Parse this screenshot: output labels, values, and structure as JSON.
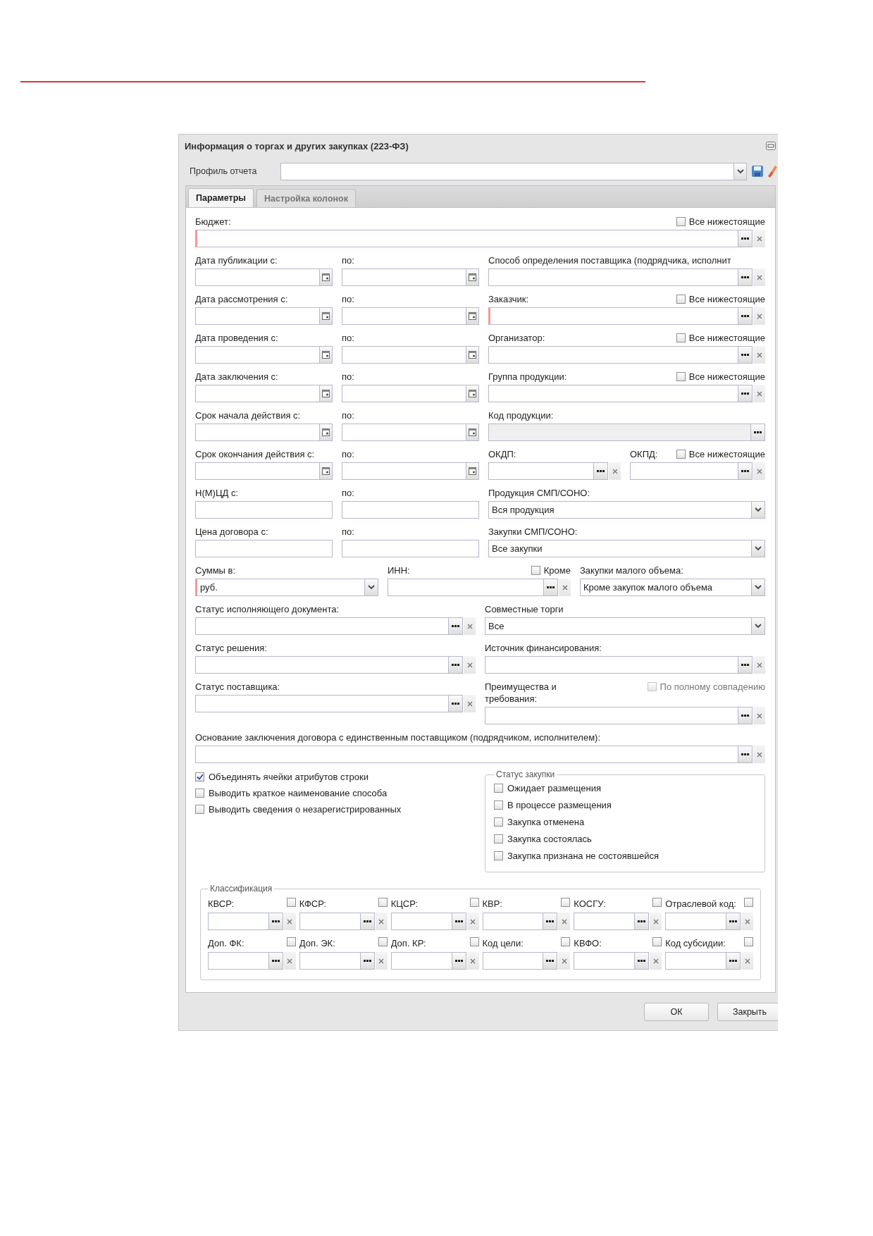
{
  "dialog": {
    "title": "Информация о торгах и других закупках (223-ФЗ)"
  },
  "profile": {
    "label": "Профиль отчета"
  },
  "tabs": [
    {
      "label": "Параметры",
      "selected": true
    },
    {
      "label": "Настройка колонок",
      "selected": false
    }
  ],
  "rows": [
    {
      "kind": "full",
      "cells": [
        {
          "label": "Бюджет:",
          "checkbox": {
            "label": "Все нижестоящие",
            "checked": false,
            "disabled": false
          },
          "field": {
            "kind": "lookup",
            "required": true,
            "disabled": false
          }
        }
      ]
    },
    {
      "kind": "dates",
      "cells": [
        {
          "label": "Дата публикации с:",
          "field": {
            "kind": "date",
            "required": false,
            "disabled": false
          }
        },
        {
          "label": "по:",
          "field": {
            "kind": "date",
            "required": false,
            "disabled": false
          }
        },
        {
          "label": "Способ определения поставщика (подрядчика, исполнит",
          "field": {
            "kind": "lookup",
            "required": false,
            "disabled": false
          }
        }
      ]
    },
    {
      "kind": "dates",
      "cells": [
        {
          "label": "Дата рассмотрения с:",
          "field": {
            "kind": "date",
            "required": false,
            "disabled": false
          }
        },
        {
          "label": "по:",
          "field": {
            "kind": "date",
            "required": false,
            "disabled": false
          }
        },
        {
          "label": "Заказчик:",
          "checkbox": {
            "label": "Все нижестоящие",
            "checked": false,
            "disabled": false
          },
          "field": {
            "kind": "lookup",
            "required": true,
            "disabled": false
          }
        }
      ]
    },
    {
      "kind": "dates",
      "cells": [
        {
          "label": "Дата проведения с:",
          "field": {
            "kind": "date",
            "required": false,
            "disabled": false
          }
        },
        {
          "label": "по:",
          "field": {
            "kind": "date",
            "required": false,
            "disabled": false
          }
        },
        {
          "label": "Организатор:",
          "checkbox": {
            "label": "Все нижестоящие",
            "checked": false,
            "disabled": false
          },
          "field": {
            "kind": "lookup",
            "required": false,
            "disabled": false
          }
        }
      ]
    },
    {
      "kind": "dates",
      "cells": [
        {
          "label": "Дата заключения с:",
          "field": {
            "kind": "date",
            "required": false,
            "disabled": false
          }
        },
        {
          "label": "по:",
          "field": {
            "kind": "date",
            "required": false,
            "disabled": false
          }
        },
        {
          "label": "Группа продукции:",
          "checkbox": {
            "label": "Все нижестоящие",
            "checked": false,
            "disabled": false
          },
          "field": {
            "kind": "lookup",
            "required": false,
            "disabled": false
          }
        }
      ]
    },
    {
      "kind": "dates",
      "cells": [
        {
          "label": "Срок начала действия с:",
          "field": {
            "kind": "date",
            "required": false,
            "disabled": false
          }
        },
        {
          "label": "по:",
          "field": {
            "kind": "date",
            "required": false,
            "disabled": false
          }
        },
        {
          "label": "Код продукции:",
          "field": {
            "kind": "picker",
            "required": false,
            "disabled": true
          }
        }
      ]
    },
    {
      "kind": "split",
      "cells": [
        {
          "label": "Срок окончания действия с:",
          "field": {
            "kind": "date",
            "required": false,
            "disabled": false
          }
        },
        {
          "label": "по:",
          "field": {
            "kind": "date",
            "required": false,
            "disabled": false
          }
        },
        {
          "label": "ОКДП:",
          "field": {
            "kind": "lookup",
            "required": false,
            "disabled": false
          }
        },
        {
          "label": "ОКПД:",
          "checkbox": {
            "label": "Все нижестоящие",
            "checked": false,
            "disabled": false
          },
          "field": {
            "kind": "lookup",
            "required": false,
            "disabled": false
          }
        }
      ]
    },
    {
      "kind": "dates",
      "cells": [
        {
          "label": "Н(М)ЦД с:",
          "field": {
            "kind": "text",
            "required": false,
            "disabled": false
          }
        },
        {
          "label": "по:",
          "field": {
            "kind": "text",
            "required": false,
            "disabled": false
          }
        },
        {
          "label": "Продукция СМП/СОНО:",
          "field": {
            "kind": "select",
            "value": "Вся продукция",
            "required": false,
            "disabled": false
          }
        }
      ]
    },
    {
      "kind": "dates",
      "cells": [
        {
          "label": "Цена договора с:",
          "field": {
            "kind": "text",
            "required": false,
            "disabled": false
          }
        },
        {
          "label": "по:",
          "field": {
            "kind": "text",
            "required": false,
            "disabled": false
          }
        },
        {
          "label": "Закупки СМП/СОНО:",
          "field": {
            "kind": "select",
            "value": "Все закупки",
            "required": false,
            "disabled": false
          }
        }
      ]
    },
    {
      "kind": "sums",
      "cells": [
        {
          "label": "Суммы в:",
          "field": {
            "kind": "select",
            "value": "руб.",
            "required": true,
            "disabled": false
          }
        },
        {
          "label": "ИНН:",
          "checkbox": {
            "label": "Кроме",
            "checked": false,
            "disabled": false
          },
          "field": {
            "kind": "lookup",
            "required": false,
            "disabled": false
          }
        },
        {
          "label": "Закупки малого объема:",
          "field": {
            "kind": "select",
            "value": "Кроме закупок малого объема",
            "required": false,
            "disabled": false
          }
        }
      ]
    },
    {
      "kind": "pair",
      "cells": [
        {
          "label": "Статус исполняющего документа:",
          "field": {
            "kind": "lookup",
            "required": false,
            "disabled": false
          }
        },
        {
          "label": "Совместные торги",
          "field": {
            "kind": "select",
            "value": "Все",
            "required": false,
            "disabled": false
          }
        }
      ]
    },
    {
      "kind": "pair",
      "cells": [
        {
          "label": "Статус решения:",
          "field": {
            "kind": "lookup",
            "required": false,
            "disabled": false
          }
        },
        {
          "label": "Источник финансирования:",
          "field": {
            "kind": "lookup",
            "required": false,
            "disabled": false
          }
        }
      ]
    },
    {
      "kind": "pair",
      "cells": [
        {
          "label": "Статус поставщика:",
          "field": {
            "kind": "lookup",
            "required": false,
            "disabled": false
          }
        },
        {
          "label": "Преимущества и требования:",
          "checkbox": {
            "label": "По полному совпадению",
            "checked": false,
            "disabled": true
          },
          "field": {
            "kind": "lookup",
            "required": false,
            "disabled": false
          }
        }
      ]
    },
    {
      "kind": "full",
      "cells": [
        {
          "label": "Основание заключения договора с единственным поставщиком (подрядчиком, исполнителем):",
          "field": {
            "kind": "lookup",
            "required": false,
            "disabled": false
          }
        }
      ]
    }
  ],
  "options": [
    {
      "label": "Объединять ячейки атрибутов строки",
      "checked": true
    },
    {
      "label": "Выводить краткое наименование способа",
      "checked": false
    },
    {
      "label": "Выводить сведения о незарегистрированных",
      "checked": false
    }
  ],
  "purchase_status": {
    "title": "Статус закупки",
    "options": [
      {
        "label": "Ожидает размещения",
        "checked": false
      },
      {
        "label": "В процессе размещения",
        "checked": false
      },
      {
        "label": "Закупка отменена",
        "checked": false
      },
      {
        "label": "Закупка состоялась",
        "checked": false
      },
      {
        "label": "Закупка признана не состоявшейся",
        "checked": false
      }
    ]
  },
  "classification": {
    "title": "Классификация",
    "cells": [
      {
        "label": "КВСР:",
        "checked": false
      },
      {
        "label": "КФСР:",
        "checked": false
      },
      {
        "label": "КЦСР:",
        "checked": false
      },
      {
        "label": "КВР:",
        "checked": false
      },
      {
        "label": "КОСГУ:",
        "checked": false
      },
      {
        "label": "Отраслевой код:",
        "checked": false
      },
      {
        "label": "Доп. ФК:",
        "checked": false
      },
      {
        "label": "Доп. ЭК:",
        "checked": false
      },
      {
        "label": "Доп. КР:",
        "checked": false
      },
      {
        "label": "Код цели:",
        "checked": false
      },
      {
        "label": "КВФО:",
        "checked": false
      },
      {
        "label": "Код субсидии:",
        "checked": false
      }
    ]
  },
  "buttons": [
    {
      "label": "ОК"
    },
    {
      "label": "Закрыть"
    }
  ]
}
